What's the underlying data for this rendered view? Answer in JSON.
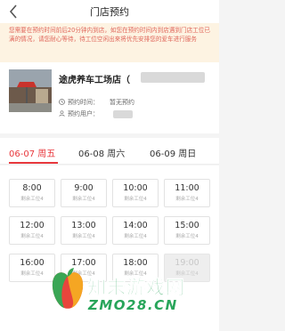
{
  "nav": {
    "title": "门店预约"
  },
  "notice": {
    "text": "您需要在预约时间前后20分钟内到店，如您在预约时间内到店遇到门店工位已满的情况，请您耐心等待，待工位空闲出来将优先安排您的爱车进行服务"
  },
  "store": {
    "name": "途虎养车工场店（",
    "time_label": "预约时间：",
    "time_value": "暂无预约",
    "user_label": "预约用户："
  },
  "tabs": [
    {
      "label": "06-07 周五",
      "active": true
    },
    {
      "label": "06-08 周六",
      "active": false
    },
    {
      "label": "06-09 周日",
      "active": false
    }
  ],
  "slots": [
    {
      "time": "8:00",
      "remaining": "剩余工位4"
    },
    {
      "time": "9:00",
      "remaining": "剩余工位4"
    },
    {
      "time": "10:00",
      "remaining": "剩余工位4"
    },
    {
      "time": "11:00",
      "remaining": "剩余工位4"
    },
    {
      "time": "12:00",
      "remaining": "剩余工位4"
    },
    {
      "time": "13:00",
      "remaining": "剩余工位4"
    },
    {
      "time": "14:00",
      "remaining": "剩余工位4"
    },
    {
      "time": "15:00",
      "remaining": "剩余工位4"
    },
    {
      "time": "16:00",
      "remaining": "剩余工位4"
    },
    {
      "time": "17:00",
      "remaining": "剩余工位4"
    },
    {
      "time": "18:00",
      "remaining": "剩余工位4"
    },
    {
      "time": "19:00",
      "remaining": "剩余工位4",
      "disabled": true
    }
  ],
  "watermark": {
    "cn": "知末游戏网",
    "en": "ZMO28.CN"
  },
  "icons": {
    "back": "chevron-left-icon",
    "time": "clock-icon",
    "user": "user-icon"
  },
  "colors": {
    "accent": "#e8383d",
    "notice_bg": "#fdf3e2",
    "notice_text": "#e0665a",
    "watermark": "#28a55a"
  }
}
